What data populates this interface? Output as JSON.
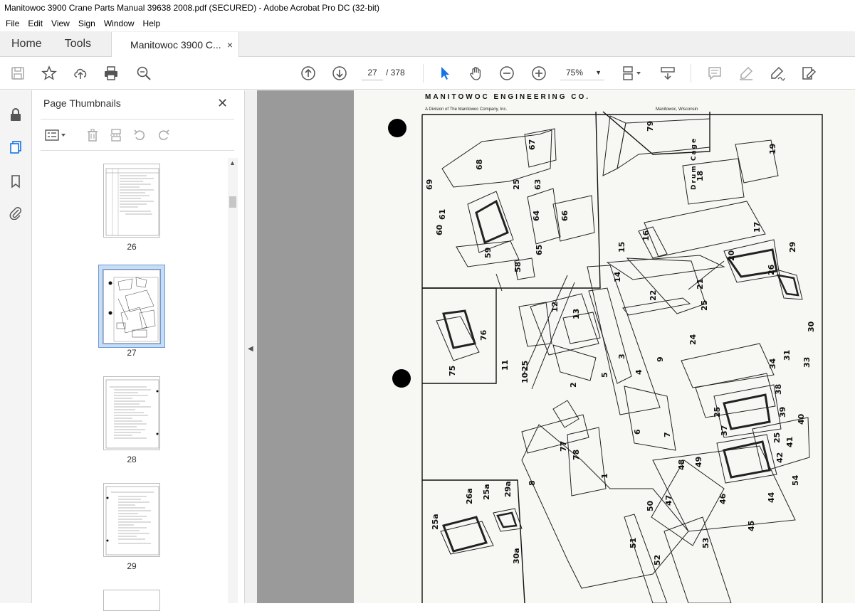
{
  "window": {
    "title": "Manitowoc 3900 Crane Parts Manual 39638 2008.pdf (SECURED) - Adobe Acrobat Pro DC (32-bit)"
  },
  "menu": [
    "File",
    "Edit",
    "View",
    "Sign",
    "Window",
    "Help"
  ],
  "tabs": {
    "home": "Home",
    "tools": "Tools",
    "document": "Manitowoc 3900 C...",
    "close": "×"
  },
  "toolbar": {
    "page_current": "27",
    "page_total": "/ 378",
    "zoom": "75%"
  },
  "panel": {
    "title": "Page Thumbnails",
    "close": "✕"
  },
  "thumbnails": [
    {
      "label": "26"
    },
    {
      "label": "27",
      "selected": true
    },
    {
      "label": "28"
    },
    {
      "label": "29"
    }
  ],
  "page": {
    "heading": "MANITOWOC ENGINEERING CO.",
    "subheading_left": "A Division of The Manitowoc Company, Inc.",
    "subheading_right": "Manitowoc, Wisconsin",
    "vertical_label": "Drum Cage",
    "callouts": [
      "79",
      "68",
      "67",
      "18",
      "19",
      "69",
      "25",
      "63",
      "61",
      "64",
      "66",
      "17",
      "60",
      "16",
      "59",
      "65",
      "58",
      "15",
      "20",
      "29",
      "14",
      "26",
      "21",
      "22",
      "25",
      "12",
      "13",
      "30",
      "76",
      "24",
      "31",
      "11",
      "25",
      "3",
      "9",
      "34",
      "33",
      "75",
      "10",
      "2",
      "5",
      "4",
      "38",
      "25",
      "37",
      "39",
      "40",
      "6",
      "7",
      "25",
      "41",
      "77",
      "78",
      "49",
      "48",
      "42",
      "8",
      "1",
      "54",
      "50",
      "47",
      "46",
      "44",
      "25a",
      "26a",
      "25a",
      "29a",
      "45",
      "51",
      "53",
      "30a",
      "52"
    ]
  },
  "colors": {
    "accent": "#1473e6",
    "selection": "#c8ddf5",
    "viewer_bg": "#9a9a9a"
  }
}
